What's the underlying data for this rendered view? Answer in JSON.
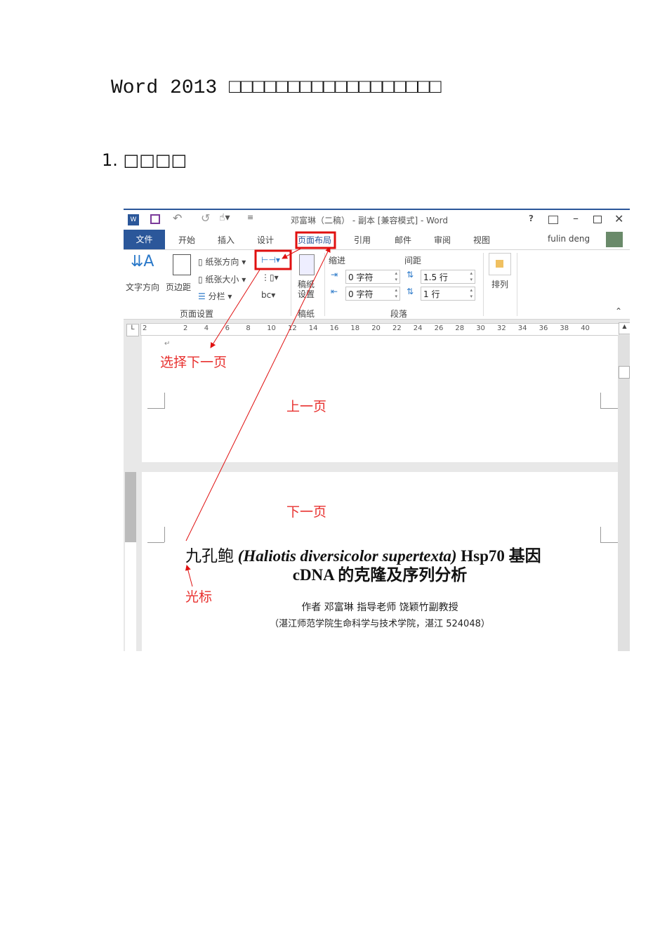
{
  "document": {
    "title": "Word 2013 □□□□□□□□□□□□□□□□□□",
    "heading": "1. □□□□"
  },
  "word_window": {
    "title": "邓富琳（二稿） - 副本 [兼容模式] - Word",
    "quick_access": [
      "word-logo",
      "save",
      "undo",
      "redo",
      "touch-mode",
      "customize"
    ],
    "window_controls": [
      "?",
      "restore-ribbon",
      "minimize",
      "maximize",
      "close"
    ],
    "user": "fulin deng",
    "tabs": [
      "文件",
      "开始",
      "插入",
      "设计",
      "页面布局",
      "引用",
      "邮件",
      "审阅",
      "视图"
    ],
    "active_tab": "页面布局",
    "ribbon": {
      "text_direction": "文字方向",
      "margins": "页边距",
      "orientation": "纸张方向",
      "size": "纸张大小",
      "columns": "分栏",
      "page_setup_group": "页面设置",
      "draft_paper": "稿纸\n设置",
      "draft_group": "稿纸",
      "indent_label": "缩进",
      "spacing_label": "间距",
      "indent_left": "0 字符",
      "indent_right": "0 字符",
      "spacing_before": "1.5 行",
      "spacing_after": "1 行",
      "paragraph_group": "段落",
      "arrange": "排列"
    },
    "ruler": {
      "ticks": [
        "2",
        "2",
        "4",
        "6",
        "8",
        "10",
        "12",
        "14",
        "16",
        "18",
        "20",
        "22",
        "24",
        "26",
        "28",
        "30",
        "32",
        "34",
        "36",
        "38",
        "40"
      ]
    },
    "annotations": {
      "select_next": "选择下一页",
      "prev_page": "上一页",
      "next_page": "下一页",
      "cursor": "光标"
    },
    "content": {
      "title_cn1": "九孔鲍",
      "title_latin": "(Haliotis diversicolor supertexta)",
      "title_cn2": " Hsp70 基因",
      "title_line2": "cDNA 的克隆及序列分析",
      "author": "作者  邓富琳    指导老师  饶颖竹副教授",
      "affiliation": "（湛江师范学院生命科学与技术学院，湛江  524048）"
    }
  }
}
